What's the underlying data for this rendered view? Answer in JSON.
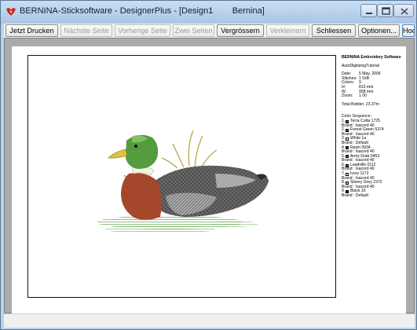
{
  "window": {
    "title": "BERNINA-Sticksoftware - DesignerPlus - [Design1        Bernina]",
    "app_icon": "bernina-logo-icon",
    "controls": {
      "minimize": "minimize-icon",
      "maximize": "maximize-icon",
      "close": "close-icon"
    }
  },
  "toolbar": {
    "buttons": [
      {
        "label": "Jetzt Drucken",
        "enabled": true
      },
      {
        "label": "Nächste Seite",
        "enabled": false
      },
      {
        "label": "Vorherige Seite",
        "enabled": false
      },
      {
        "label": "Zwei Seiten",
        "enabled": false
      },
      {
        "label": "Vergrössern",
        "enabled": true
      },
      {
        "label": "Verkleinern",
        "enabled": false
      },
      {
        "label": "Schliessen",
        "enabled": true
      },
      {
        "label": "Optionen...",
        "enabled": true
      },
      {
        "label": "Hochformat",
        "enabled": true
      }
    ]
  },
  "info": {
    "header": "BERNINA Embroidery Software",
    "design_name": "AutoDigitizingTutorial",
    "stats": [
      {
        "key": "Date:",
        "value": "5 May, 2006"
      },
      {
        "key": "Stitches:",
        "value": "1 0xB"
      },
      {
        "key": "Colors:",
        "value": "9"
      },
      {
        "key": "H:",
        "value": "813 mm"
      },
      {
        "key": "W:",
        "value": "958 mm"
      },
      {
        "key": "Zoom:",
        "value": "1 00"
      }
    ],
    "total_bobbin": "Total Bobbin:     23.37m",
    "sequence_title": "Color Sequence :",
    "sequence": [
      {
        "num": "1.",
        "color": "#b8322a",
        "name": "Terra Cotta 1725",
        "brand": "Brand : Isacord 40"
      },
      {
        "num": "2.",
        "color": "#2e6b2a",
        "name": "Forest Green 5374",
        "brand": "Brand : Isacord 40"
      },
      {
        "num": "3.",
        "color": "#ffffff",
        "name": "White 1a",
        "brand": "Brand : Default"
      },
      {
        "num": "4.",
        "color": "#8a1a14",
        "name": "Rasin 0934",
        "brand": "Brand : Isacord 40"
      },
      {
        "num": "5.",
        "color": "#3f5a2c",
        "name": "Army Drab 0453",
        "brand": "Brand : Isacord 40"
      },
      {
        "num": "6.",
        "color": "#4a4a4a",
        "name": "Leadville 0112",
        "brand": "Brand : Isacord 40"
      },
      {
        "num": "7.",
        "color": "#f3eee0",
        "name": "Ivory 1172",
        "brand": "Brand : Isacord 40"
      },
      {
        "num": "8.",
        "color": "#c9c9c9",
        "name": "Silvery Grey 1972",
        "brand": "Brand : Isacord 40"
      },
      {
        "num": "9.",
        "color": "#000000",
        "name": "Black 15",
        "brand": "Brand : Default"
      }
    ]
  },
  "colors": {
    "titlebar_top": "#c9def3",
    "titlebar_bottom": "#a9c6e6",
    "preview_bg": "#ababab"
  }
}
